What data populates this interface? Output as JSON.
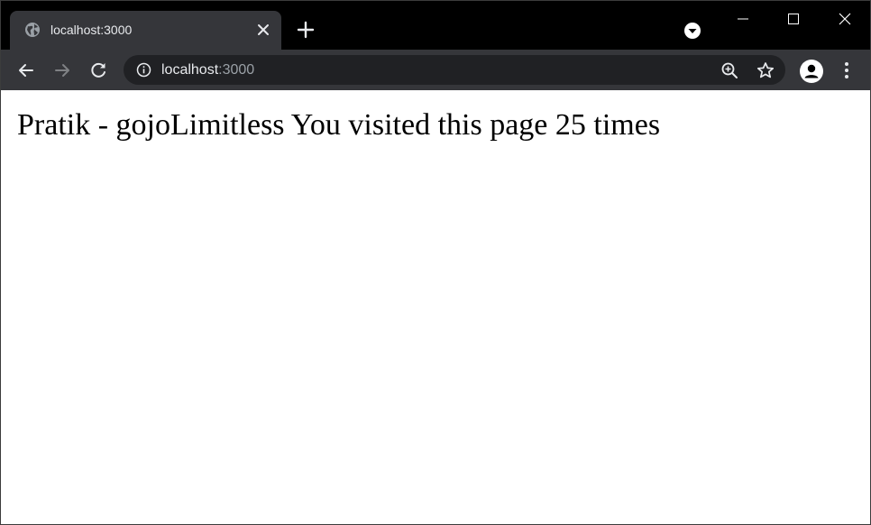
{
  "browser": {
    "tab": {
      "title": "localhost:3000",
      "favicon_icon": "globe-icon",
      "close_icon": "close-icon"
    },
    "new_tab_icon": "plus-icon",
    "tab_search_icon": "chevron-down-circle-icon",
    "window_controls": {
      "minimize_icon": "minimize-icon",
      "maximize_icon": "maximize-icon",
      "close_icon": "window-close-icon"
    },
    "toolbar": {
      "back_icon": "arrow-left-icon",
      "forward_icon": "arrow-right-icon",
      "reload_icon": "reload-icon",
      "site_info_icon": "info-icon",
      "url_host": "localhost",
      "url_port": ":3000",
      "zoom_icon": "zoom-in-icon",
      "bookmark_icon": "star-icon",
      "profile_icon": "person-icon",
      "menu_icon": "more-vertical-icon"
    }
  },
  "page": {
    "text": "Pratik - gojoLimitless You visited this page 25 times"
  },
  "colors": {
    "titlebar": "#000000",
    "tab_active": "#35363a",
    "toolbar": "#35363a",
    "omnibox": "#202124",
    "text_light": "#e8eaed",
    "text_muted": "#9aa0a6",
    "page_background": "#ffffff"
  }
}
